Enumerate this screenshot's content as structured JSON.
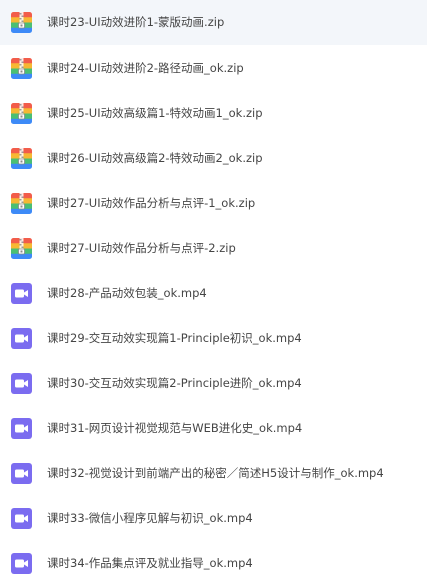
{
  "files": [
    {
      "name": "课时23-UI动效进阶1-蒙版动画.zip",
      "type": "zip",
      "icon": "zip-archive-icon"
    },
    {
      "name": "课时24-UI动效进阶2-路径动画_ok.zip",
      "type": "zip",
      "icon": "zip-archive-icon"
    },
    {
      "name": "课时25-UI动效高级篇1-特效动画1_ok.zip",
      "type": "zip",
      "icon": "zip-archive-icon"
    },
    {
      "name": "课时26-UI动效高级篇2-特效动画2_ok.zip",
      "type": "zip",
      "icon": "zip-archive-icon"
    },
    {
      "name": "课时27-UI动效作品分析与点评-1_ok.zip",
      "type": "zip",
      "icon": "zip-archive-icon"
    },
    {
      "name": "课时27-UI动效作品分析与点评-2.zip",
      "type": "zip",
      "icon": "zip-archive-icon"
    },
    {
      "name": "课时28-产品动效包装_ok.mp4",
      "type": "video",
      "icon": "video-file-icon"
    },
    {
      "name": "课时29-交互动效实现篇1-Principle初识_ok.mp4",
      "type": "video",
      "icon": "video-file-icon"
    },
    {
      "name": "课时30-交互动效实现篇2-Principle进阶_ok.mp4",
      "type": "video",
      "icon": "video-file-icon"
    },
    {
      "name": "课时31-网页设计视觉规范与WEB进化史_ok.mp4",
      "type": "video",
      "icon": "video-file-icon"
    },
    {
      "name": "课时32-视觉设计到前端产出的秘密／简述H5设计与制作_ok.mp4",
      "type": "video",
      "icon": "video-file-icon"
    },
    {
      "name": "课时33-微信小程序见解与初识_ok.mp4",
      "type": "video",
      "icon": "video-file-icon"
    },
    {
      "name": "课时34-作品集点评及就业指导_ok.mp4",
      "type": "video",
      "icon": "video-file-icon"
    }
  ],
  "colors": {
    "video_icon": "#7b6cf0",
    "zip_top": "#f25c4a",
    "zip_upper_mid": "#f7b733",
    "zip_lower_mid": "#4bbf73",
    "zip_bottom": "#3d8af7",
    "text": "#454545",
    "hover_row": "#f3f6fa"
  }
}
